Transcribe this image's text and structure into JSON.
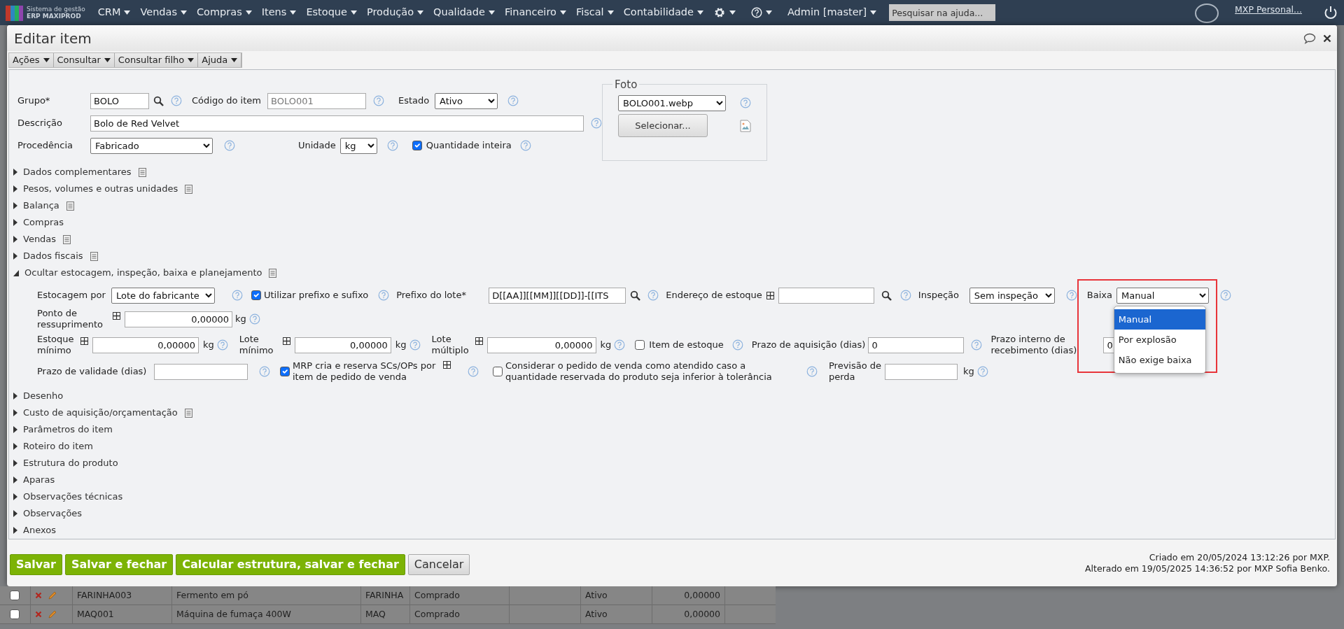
{
  "top_nav": {
    "brand_line1": "Sistema de gestão",
    "brand_line2": "ERP MAXIPROD",
    "menus": [
      "CRM",
      "Vendas",
      "Compras",
      "Itens",
      "Estoque",
      "Produção",
      "Qualidade",
      "Financeiro",
      "Fiscal",
      "Contabilidade"
    ],
    "user": "Admin [master]",
    "search": {
      "placeholder": "Pesquisar na ajuda..."
    },
    "account": "MXP Personal..."
  },
  "dialog": {
    "title": "Editar item",
    "toolbar": [
      "Ações",
      "Consultar",
      "Consultar filho",
      "Ajuda"
    ],
    "main_fields": {
      "group": {
        "label": "Grupo*",
        "value": "BOLO"
      },
      "item_code": {
        "label": "Código do item",
        "value": "BOLO001",
        "disabled": true
      },
      "status": {
        "label": "Estado",
        "value": "Ativo"
      },
      "description": {
        "label": "Descrição",
        "value": "Bolo de Red Velvet"
      },
      "origin": {
        "label": "Procedência",
        "value": "Fabricado"
      },
      "unit": {
        "label": "Unidade",
        "value": "kg"
      },
      "integer_qty": {
        "label": "Quantidade inteira",
        "checked": true
      }
    },
    "photo": {
      "legend": "Foto",
      "file": "BOLO001.webp",
      "button": "Selecionar..."
    },
    "sections": [
      {
        "label": "Dados complementares",
        "expanded": false,
        "has_note": true
      },
      {
        "label": "Pesos, volumes e outras unidades",
        "expanded": false,
        "has_note": true
      },
      {
        "label": "Balança",
        "expanded": false,
        "has_note": true
      },
      {
        "label": "Compras",
        "expanded": false,
        "has_note": false
      },
      {
        "label": "Vendas",
        "expanded": false,
        "has_note": true
      },
      {
        "label": "Dados fiscais",
        "expanded": false,
        "has_note": true
      },
      {
        "label": "Ocultar estocagem, inspeção, baixa e planejamento",
        "expanded": true,
        "has_note": true
      },
      {
        "label": "Desenho",
        "expanded": false,
        "has_note": false
      },
      {
        "label": "Custo de aquisição/orçamentação",
        "expanded": false,
        "has_note": true
      },
      {
        "label": "Parâmetros do item",
        "expanded": false,
        "has_note": false
      },
      {
        "label": "Roteiro do item",
        "expanded": false,
        "has_note": false
      },
      {
        "label": "Estrutura do produto",
        "expanded": false,
        "has_note": false
      },
      {
        "label": "Aparas",
        "expanded": false,
        "has_note": false
      },
      {
        "label": "Observações técnicas",
        "expanded": false,
        "has_note": false
      },
      {
        "label": "Observações",
        "expanded": false,
        "has_note": false
      },
      {
        "label": "Anexos",
        "expanded": false,
        "has_note": false
      }
    ],
    "stock_fields": {
      "stock_by": {
        "label": "Estocagem por",
        "value": "Lote do fabricante"
      },
      "use_prefix": {
        "label": "Utilizar prefixo e sufixo",
        "checked": true
      },
      "lot_prefix": {
        "label": "Prefixo do lote*",
        "value": "D[[AA]][[MM]][[DD]]-[[ITS"
      },
      "stock_address": {
        "label": "Endereço de estoque"
      },
      "inspection": {
        "label": "Inspeção",
        "value": "Sem inspeção"
      },
      "consumption": {
        "label": "Baixa",
        "value": "Manual",
        "open": true,
        "highlighted": true,
        "options": [
          {
            "label": "Manual",
            "selected": true
          },
          {
            "label": "Por explosão",
            "selected": false
          },
          {
            "label": "Não exige baixa",
            "selected": false
          }
        ]
      },
      "reorder_point": {
        "label": "Ponto de ressuprimento",
        "value": "0,00000",
        "unit": "kg"
      },
      "min_stock": {
        "label": "Estoque mínimo",
        "value": "0,00000",
        "unit": "kg"
      },
      "min_lot": {
        "label": "Lote mínimo",
        "value": "0,00000",
        "unit": "kg"
      },
      "multiple_lot": {
        "label": "Lote múltiplo",
        "value": "0,00000",
        "unit": "kg"
      },
      "stock_item": {
        "label": "Item de estoque",
        "checked": false
      },
      "lead_time": {
        "label": "Prazo de aquisição (dias)",
        "value": "0"
      },
      "internal_receipt": {
        "label": "Prazo interno de recebimento (dias)",
        "value": "0"
      },
      "shelf_life": {
        "label": "Prazo de validade (dias)"
      },
      "mrp": {
        "label": "MRP cria e reserva SCs/OPs por item de pedido de venda",
        "checked": true
      },
      "consider": {
        "label": "Considerar o pedido de venda como atendido caso a quantidade reservada do produto seja inferior à tolerância",
        "checked": false
      },
      "loss_forecast": {
        "label": "Previsão de perda",
        "unit": "kg"
      }
    },
    "buttons": [
      {
        "label": "Salvar",
        "kind": "primary"
      },
      {
        "label": "Salvar e fechar",
        "kind": "primary"
      },
      {
        "label": "Calcular estrutura, salvar e fechar",
        "kind": "primary"
      },
      {
        "label": "Cancelar",
        "kind": "secondary"
      }
    ],
    "audit": [
      "Criado em 20/05/2024 13:12:26 por MXP.",
      "Alterado em 19/05/2025 14:36:52 por MXP Sofia Benko."
    ]
  },
  "background_rows": [
    {
      "checked": false,
      "code": "FARINHA003",
      "description": "Fermento em pó",
      "group": "FARINHA",
      "origin": "Comprado",
      "status": "Ativo",
      "quantity": "0,00000"
    },
    {
      "checked": false,
      "code": "MAQ001",
      "description": "Máquina de fumaça 400W",
      "group": "MAQ",
      "origin": "Comprado",
      "status": "Ativo",
      "quantity": "0,00000"
    }
  ]
}
